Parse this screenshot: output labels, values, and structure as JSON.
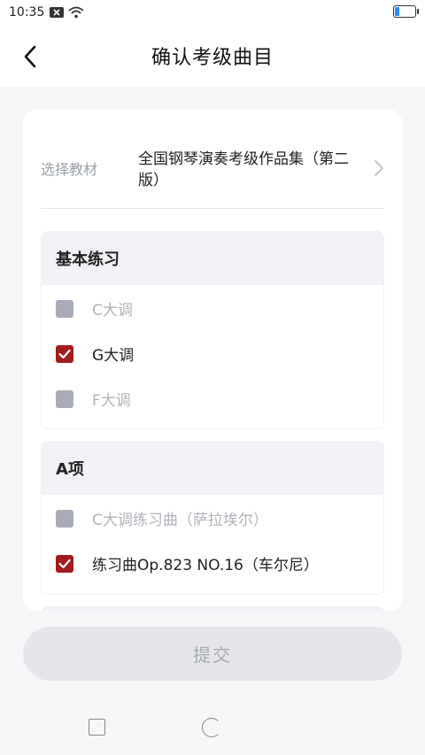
{
  "status_bar": {
    "time": "10:35",
    "icons": [
      "notification-x-icon",
      "wifi-icon",
      "battery-icon"
    ],
    "battery_color": "#2a8cff"
  },
  "header": {
    "title": "确认考级曲目",
    "back_icon": "chevron-left-icon"
  },
  "textbook": {
    "label": "选择教材",
    "value": "全国钢琴演奏考级作品集（第二版）",
    "chevron_icon": "chevron-right-icon"
  },
  "sections": [
    {
      "title": "基本练习",
      "items": [
        {
          "label": "C大调",
          "checked": false
        },
        {
          "label": "G大调",
          "checked": true
        },
        {
          "label": "F大调",
          "checked": false
        }
      ]
    },
    {
      "title": "A项",
      "items": [
        {
          "label": "C大调练习曲（萨拉埃尔）",
          "checked": false
        },
        {
          "label": "练习曲Op.823  NO.16（车尔尼）",
          "checked": true
        }
      ]
    }
  ],
  "submit_label": "提交",
  "colors": {
    "accent": "#a31b1b",
    "unchecked": "#a9acb8",
    "section_header_bg": "#f0f2f6"
  }
}
